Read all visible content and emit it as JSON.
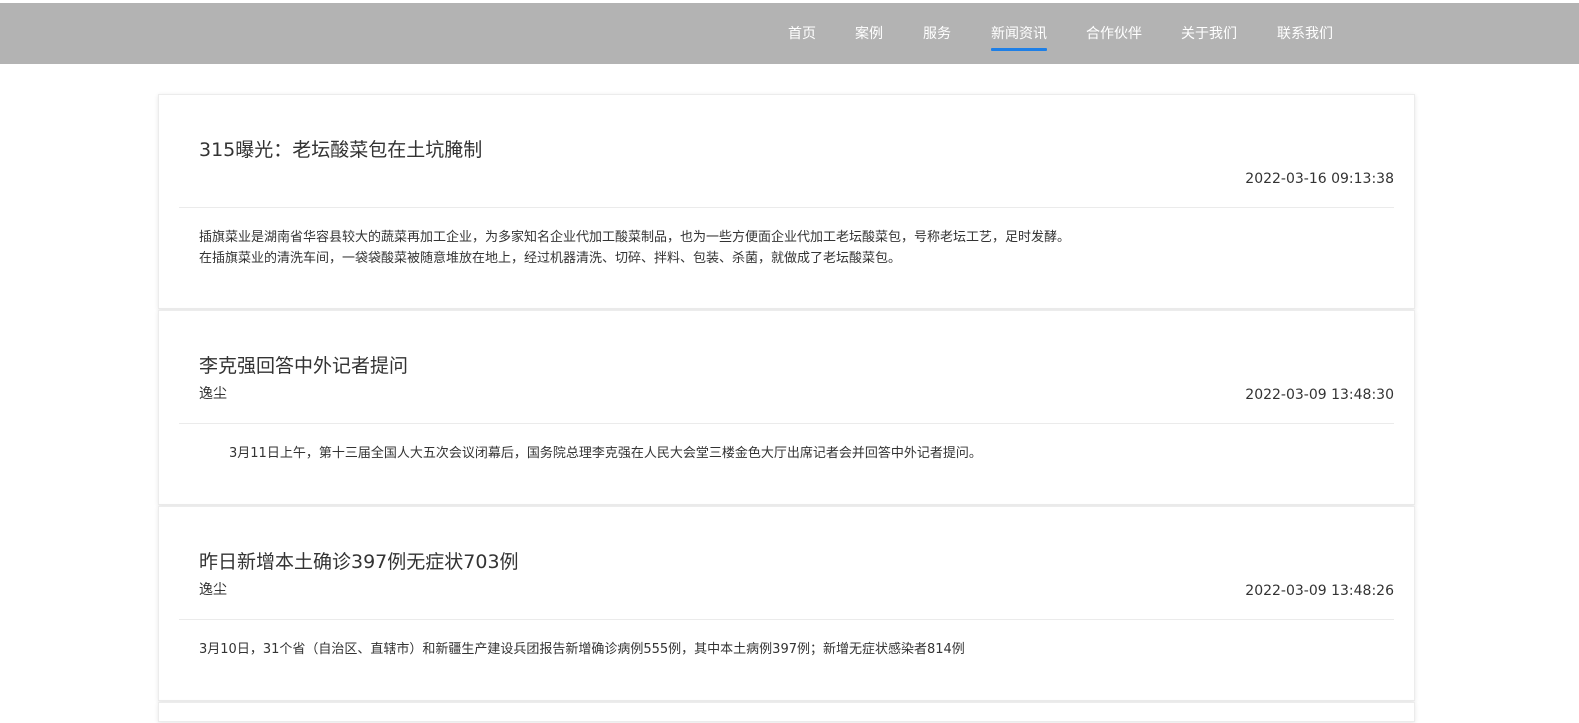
{
  "nav": {
    "items": [
      {
        "label": "首页",
        "active": false
      },
      {
        "label": "案例",
        "active": false
      },
      {
        "label": "服务",
        "active": false
      },
      {
        "label": "新闻资讯",
        "active": true
      },
      {
        "label": "合作伙伴",
        "active": false
      },
      {
        "label": "关于我们",
        "active": false
      },
      {
        "label": "联系我们",
        "active": false
      }
    ]
  },
  "colors": {
    "navbar_bg": "#b3b3b3",
    "nav_active_underline": "#1e7fe6",
    "text": "#333333"
  },
  "news": [
    {
      "title": "315曝光：老坛酸菜包在土坑腌制",
      "author": "",
      "time": "2022-03-16 09:13:38",
      "summary_lines": [
        "插旗菜业是湖南省华容县较大的蔬菜再加工企业，为多家知名企业代加工酸菜制品，也为一些方便面企业代加工老坛酸菜包，号称老坛工艺，足时发酵。",
        "在插旗菜业的清洗车间，一袋袋酸菜被随意堆放在地上，经过机器清洗、切碎、拌料、包装、杀菌，就做成了老坛酸菜包。"
      ]
    },
    {
      "title": "李克强回答中外记者提问",
      "author": "逸尘",
      "time": "2022-03-09 13:48:30",
      "summary_lines": [
        "3月11日上午，第十三届全国人大五次会议闭幕后，国务院总理李克强在人民大会堂三楼金色大厅出席记者会并回答中外记者提问。"
      ]
    },
    {
      "title": "昨日新增本土确诊397例无症状703例",
      "author": "逸尘",
      "time": "2022-03-09 13:48:26",
      "summary_lines": [
        "3月10日，31个省（自治区、直辖市）和新疆生产建设兵团报告新增确诊病例555例，其中本土病例397例；新增无症状感染者814例"
      ]
    }
  ]
}
